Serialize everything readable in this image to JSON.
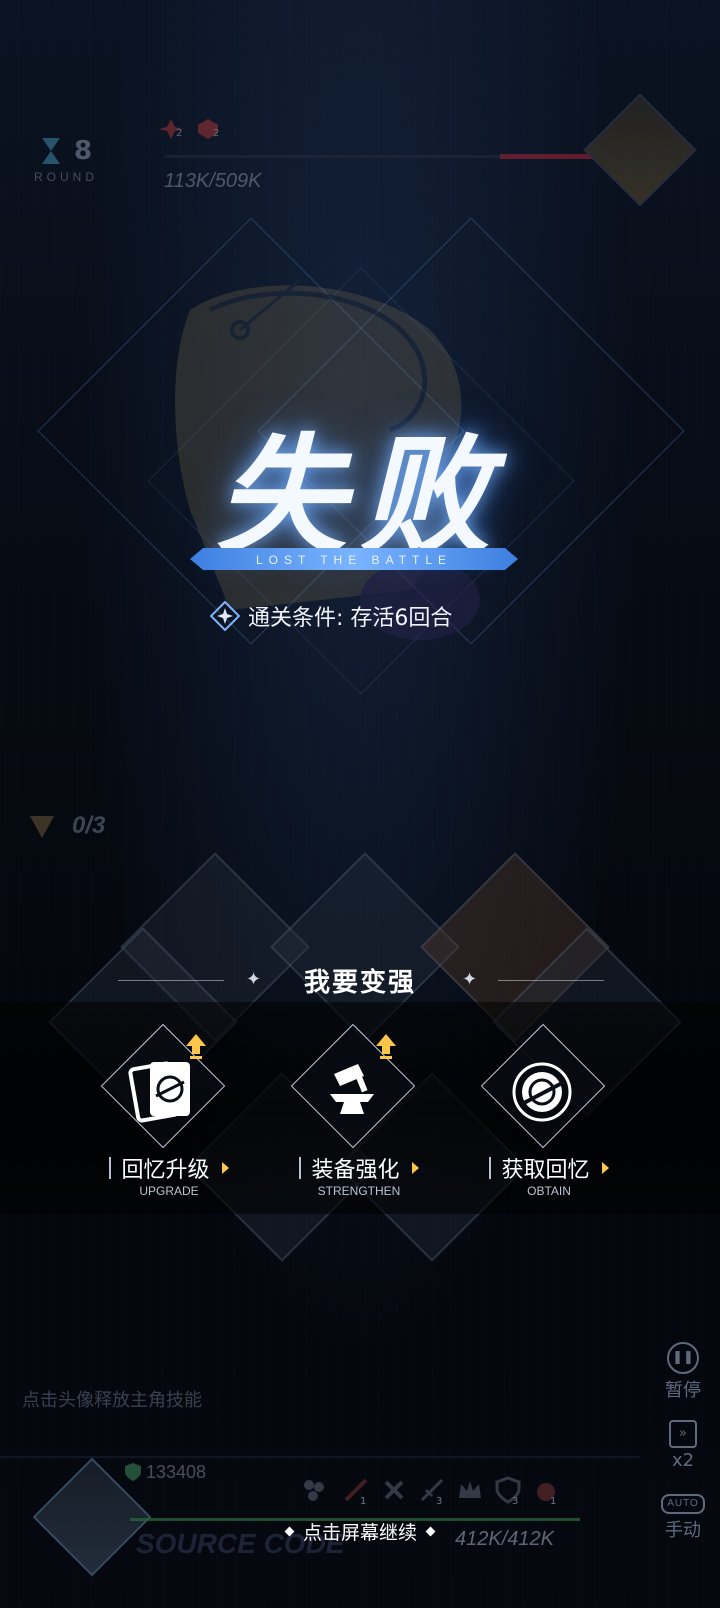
{
  "hud_top": {
    "round_number": "8",
    "round_label": "ROUND",
    "enemy_hp_text": "113K/509K",
    "enemy_hp_fraction": 0.22,
    "buff_counts": [
      "2",
      "2"
    ]
  },
  "result": {
    "title": "失败",
    "subtitle": "LOST THE BATTLE",
    "condition": "通关条件: 存活6回合"
  },
  "progress_counter": "0/3",
  "become_stronger": {
    "title": "我要变强",
    "options": [
      {
        "label": "回忆升级",
        "sub": "UPGRADE",
        "has_up_arrow": true,
        "icon": "memory-card-icon"
      },
      {
        "label": "装备强化",
        "sub": "STRENGTHEN",
        "has_up_arrow": true,
        "icon": "anvil-icon"
      },
      {
        "label": "获取回忆",
        "sub": "OBTAIN",
        "has_up_arrow": false,
        "icon": "gacha-orb-icon"
      }
    ]
  },
  "controls": {
    "pause_label": "暂停",
    "speed_label": "x2",
    "auto_badge": "AUTO",
    "manual_label": "手动"
  },
  "hud_bottom": {
    "hint": "点击头像释放主角技能",
    "shield_value": "133408",
    "player_hp_text": "412K/412K",
    "source_code": "SOURCE CODE",
    "skill_counts": [
      "1",
      "3",
      "3",
      "1"
    ]
  },
  "continue_text": "点击屏幕继续",
  "colors": {
    "accent_blue": "#5aa0ff",
    "arrow_gold": "#ffc54a",
    "enemy_hp_red": "#c8283a"
  }
}
